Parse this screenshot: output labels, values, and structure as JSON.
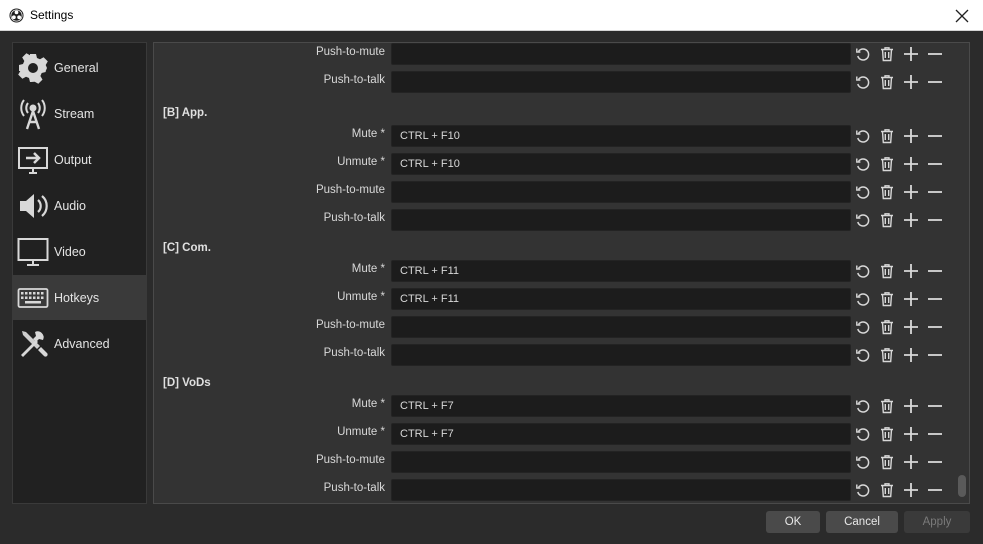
{
  "window": {
    "title": "Settings"
  },
  "sidebar": {
    "items": [
      {
        "label": "General",
        "icon": "gear-icon"
      },
      {
        "label": "Stream",
        "icon": "antenna-icon"
      },
      {
        "label": "Output",
        "icon": "output-icon"
      },
      {
        "label": "Audio",
        "icon": "speaker-icon"
      },
      {
        "label": "Video",
        "icon": "monitor-icon"
      },
      {
        "label": "Hotkeys",
        "icon": "keyboard-icon"
      },
      {
        "label": "Advanced",
        "icon": "tools-icon"
      }
    ],
    "active": "Hotkeys"
  },
  "hotkeys": {
    "top_rows": [
      {
        "label": "Push-to-mute",
        "value": ""
      },
      {
        "label": "Push-to-talk",
        "value": ""
      }
    ],
    "sections": [
      {
        "title": "[B] App.",
        "rows": [
          {
            "label": "Mute *",
            "value": "CTRL + F10"
          },
          {
            "label": "Unmute *",
            "value": "CTRL + F10"
          },
          {
            "label": "Push-to-mute",
            "value": ""
          },
          {
            "label": "Push-to-talk",
            "value": ""
          }
        ]
      },
      {
        "title": "[C] Com.",
        "rows": [
          {
            "label": "Mute *",
            "value": "CTRL + F11"
          },
          {
            "label": "Unmute *",
            "value": "CTRL + F11"
          },
          {
            "label": "Push-to-mute",
            "value": ""
          },
          {
            "label": "Push-to-talk",
            "value": ""
          }
        ]
      },
      {
        "title": "[D] VoDs",
        "rows": [
          {
            "label": "Mute *",
            "value": "CTRL + F7"
          },
          {
            "label": "Unmute *",
            "value": "CTRL + F7"
          },
          {
            "label": "Push-to-mute",
            "value": ""
          },
          {
            "label": "Push-to-talk",
            "value": ""
          }
        ]
      }
    ],
    "row_actions": [
      "revert-icon",
      "trash-icon",
      "plus-icon",
      "minus-icon"
    ]
  },
  "footer": {
    "ok_label": "OK",
    "cancel_label": "Cancel",
    "apply_label": "Apply"
  },
  "colors": {
    "background": "#2b2b2b",
    "sidebar_active": "#3a3a3a",
    "field": "#1c1c1c",
    "accent_text": "#d8d8d8"
  }
}
